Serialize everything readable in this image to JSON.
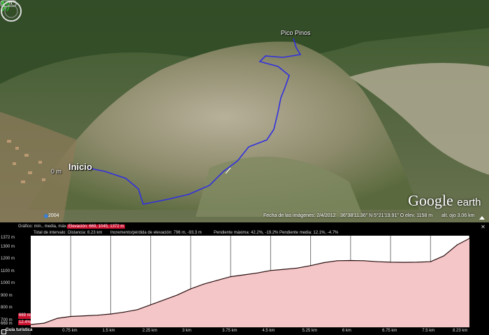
{
  "map": {
    "peak_label": "Pico Pinos",
    "start_label": "Inicio",
    "start_distance": "0 m",
    "logo_main": "Google",
    "logo_sub": "earth",
    "year": "2004",
    "status": {
      "date": "Fecha de las imágenes: 2/4/2012",
      "lat": "36°38'11.36\" N",
      "lon": "5°21'19.91\" O",
      "elev": "elev. 1158 m",
      "eye": "alt. ojo 3.06 km"
    },
    "colors": {
      "track": "#3030e0"
    }
  },
  "profile": {
    "header": {
      "chart_label": "Gráfico: mín., media, máx.:",
      "elevation_label": "Elevación: 669, 1045, 1372 m",
      "interval_label": "Total de intervalo:",
      "distance": "Distancia: 8.23 km",
      "gain_loss": "Incremento/pérdida de elevación: 796 m, -93.3 m",
      "max_slope": "Pendiente máxima: 42.2%, -19.2%",
      "avg_slope": "Pendiente media: 12.1%, -4.7%"
    },
    "min_marker_elev": "669 m",
    "min_marker_slope": "12.4%",
    "guide_button": "Guía turística"
  },
  "chart_data": {
    "type": "area",
    "title": "",
    "xlabel": "",
    "ylabel": "",
    "x_ticks": [
      "0.75 km",
      "1.5 km",
      "2.25 km",
      "3 km",
      "3.75 km",
      "4.5 km",
      "5.25 km",
      "6 km",
      "6.75 km",
      "7.5 km",
      "8.23 km"
    ],
    "y_ticks": [
      "1372 m",
      "1300 m",
      "1200 m",
      "1100 m",
      "1000 m",
      "900 m",
      "800 m",
      "700 m",
      "669 m"
    ],
    "xlim": [
      0,
      8.23
    ],
    "ylim": [
      669,
      1372
    ],
    "x": [
      0,
      0.25,
      0.5,
      0.75,
      1.0,
      1.25,
      1.5,
      1.75,
      2.0,
      2.25,
      2.5,
      2.75,
      3.0,
      3.25,
      3.5,
      3.75,
      4.0,
      4.25,
      4.5,
      4.75,
      5.0,
      5.25,
      5.5,
      5.75,
      6.0,
      6.25,
      6.5,
      6.75,
      7.0,
      7.25,
      7.5,
      7.75,
      8.0,
      8.23
    ],
    "y": [
      669,
      680,
      720,
      735,
      740,
      745,
      755,
      770,
      790,
      830,
      870,
      910,
      960,
      1000,
      1030,
      1060,
      1075,
      1090,
      1110,
      1120,
      1130,
      1150,
      1175,
      1190,
      1192,
      1190,
      1182,
      1178,
      1177,
      1178,
      1182,
      1230,
      1320,
      1372
    ],
    "colors": {
      "fill": "#f5c6c8",
      "line": "#2a1010",
      "background": "#ffffff",
      "grid": "#777777"
    }
  }
}
